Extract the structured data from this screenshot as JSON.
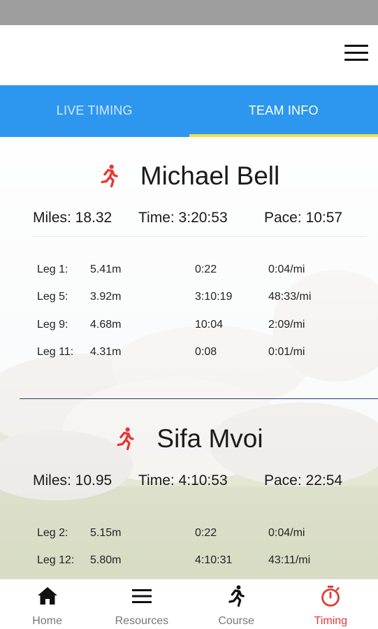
{
  "tabs": [
    {
      "label": "LIVE TIMING",
      "active": false
    },
    {
      "label": "TEAM INFO",
      "active": true
    }
  ],
  "colors": {
    "tab_bar": "#2d97f0",
    "tab_indicator": "#f5dd3a",
    "runner_icon": "#e53935",
    "active_nav": "#e53935"
  },
  "runners": [
    {
      "name": "Michael Bell",
      "miles": "Miles: 18.32",
      "time": "Time: 3:20:53",
      "pace": "Pace: 10:57",
      "legs": [
        {
          "leg": "Leg 1:",
          "distance": "5.41m",
          "time": "0:22",
          "pace": "0:04/mi"
        },
        {
          "leg": "Leg 5:",
          "distance": "3.92m",
          "time": "3:10:19",
          "pace": "48:33/mi"
        },
        {
          "leg": "Leg 9:",
          "distance": "4.68m",
          "time": "10:04",
          "pace": "2:09/mi"
        },
        {
          "leg": "Leg 11:",
          "distance": "4.31m",
          "time": "0:08",
          "pace": "0:01/mi"
        }
      ]
    },
    {
      "name": "Sifa Mvoi",
      "miles": "Miles: 10.95",
      "time": "Time: 4:10:53",
      "pace": "Pace: 22:54",
      "legs": [
        {
          "leg": "Leg 2:",
          "distance": "5.15m",
          "time": "0:22",
          "pace": "0:04/mi"
        },
        {
          "leg": "Leg 12:",
          "distance": "5.80m",
          "time": "4:10:31",
          "pace": "43:11/mi"
        }
      ]
    }
  ],
  "bottom_nav": [
    {
      "label": "Home",
      "icon": "home-icon",
      "active": false
    },
    {
      "label": "Resources",
      "icon": "list-icon",
      "active": false
    },
    {
      "label": "Course",
      "icon": "runner-icon",
      "active": false
    },
    {
      "label": "Timing",
      "icon": "stopwatch-icon",
      "active": true
    }
  ]
}
